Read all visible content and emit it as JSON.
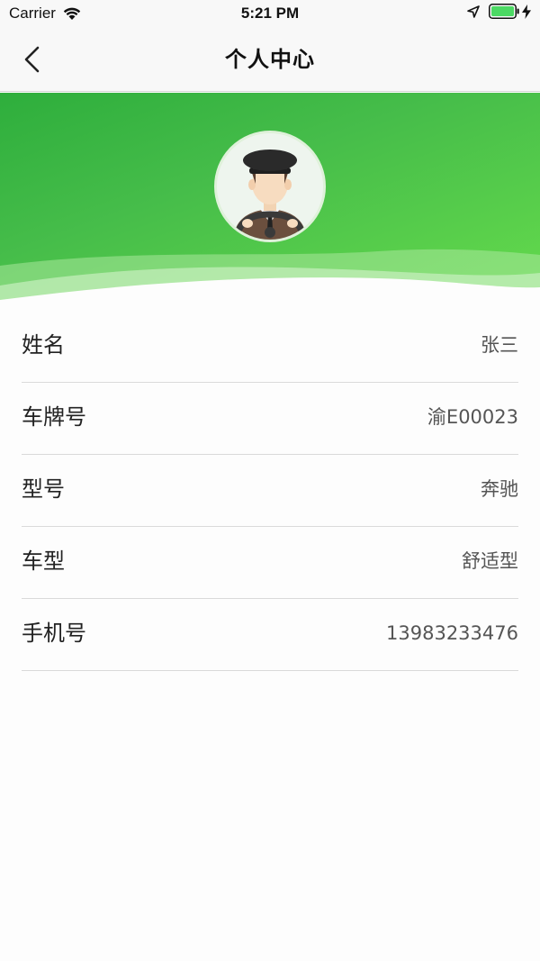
{
  "status_bar": {
    "carrier": "Carrier",
    "time": "5:21 PM",
    "battery_color": "#4cd964"
  },
  "nav": {
    "title": "个人中心",
    "back_icon": "chevron-left-icon"
  },
  "banner": {
    "gradient_start": "#2eae3c",
    "gradient_end": "#66dc4c",
    "avatar_icon": "driver-avatar-icon"
  },
  "profile": {
    "rows": [
      {
        "label": "姓名",
        "value": "张三"
      },
      {
        "label": "车牌号",
        "value": "渝E00023"
      },
      {
        "label": "型号",
        "value": "奔驰"
      },
      {
        "label": "车型",
        "value": "舒适型"
      },
      {
        "label": "手机号",
        "value": "13983233476"
      }
    ]
  }
}
